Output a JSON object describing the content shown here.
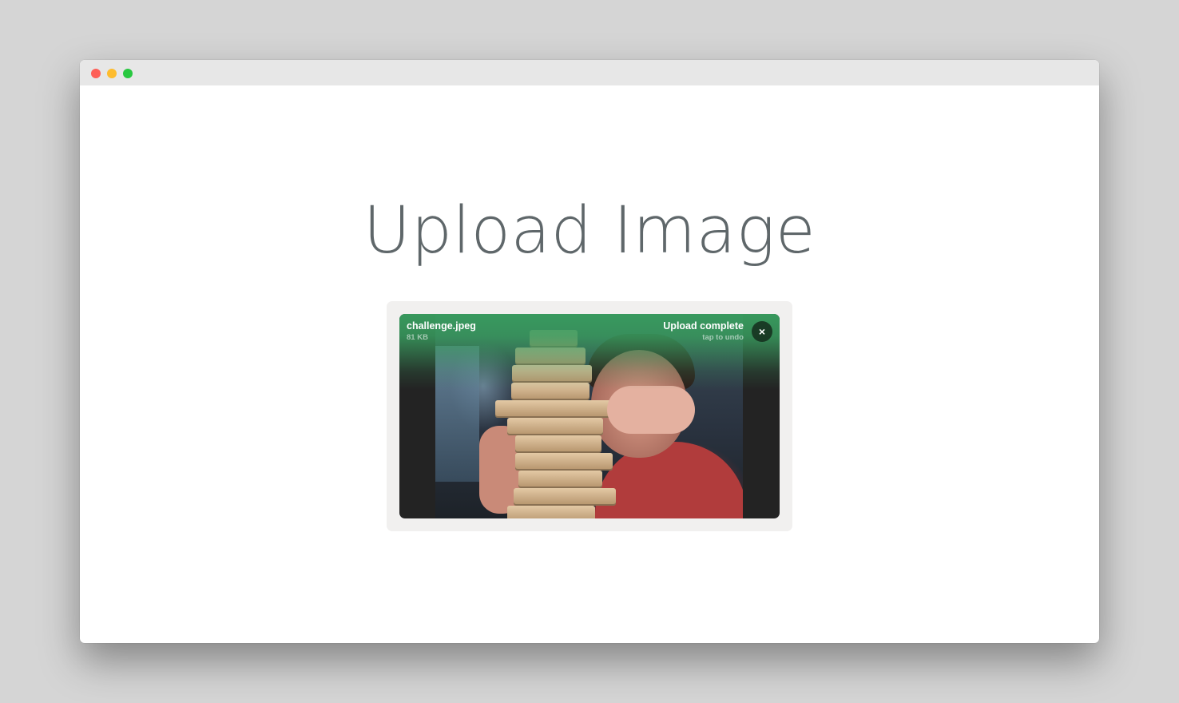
{
  "window": {
    "controls": [
      "close",
      "minimize",
      "maximize"
    ]
  },
  "page": {
    "title": "Upload Image"
  },
  "upload": {
    "file_name": "challenge.jpeg",
    "file_size": "81 KB",
    "status": "Upload complete",
    "undo_label": "tap to undo",
    "remove_icon": "×",
    "progress": 1.0,
    "accent_color": "#389b5e"
  }
}
